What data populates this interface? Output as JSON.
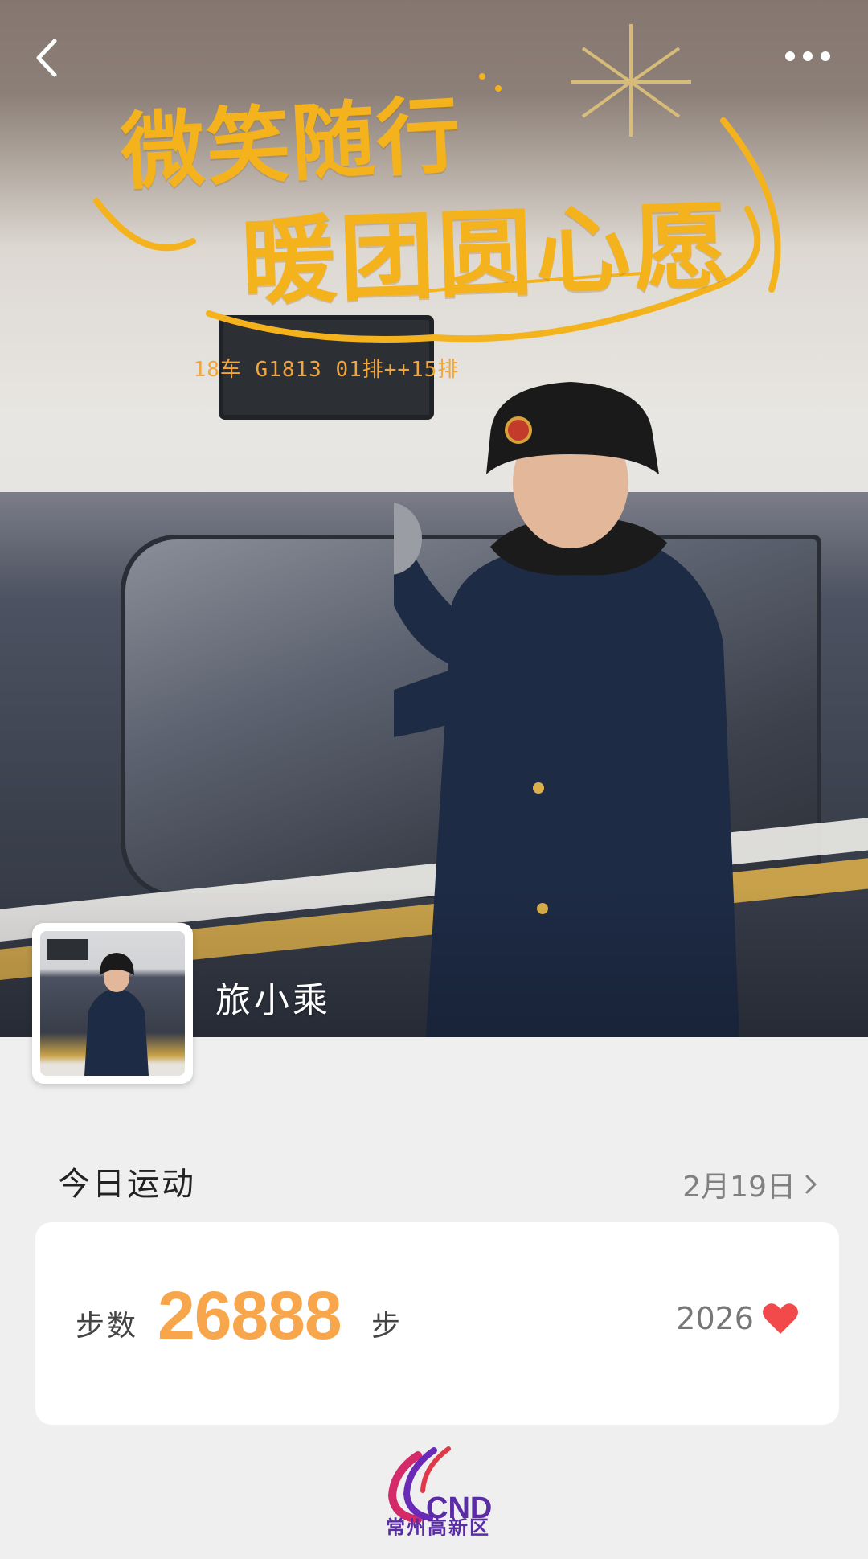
{
  "hero": {
    "headline_line1": "微笑随行",
    "headline_line2": "暖团圆心愿",
    "led_sign_text": "18车 G1813 01排++15排"
  },
  "nav": {
    "back_icon": "chevron-left-icon",
    "more_icon": "more-dots-icon"
  },
  "profile": {
    "name": "旅小乘"
  },
  "exercise": {
    "title": "今日运动",
    "date": "2月19日",
    "steps_label": "步数",
    "steps_value": "26888",
    "steps_unit": "步",
    "likes": "2026",
    "heart_color": "#f24a4a",
    "steps_color": "#f7a64b"
  },
  "logo": {
    "mark": "CND",
    "subtitle": "常州高新区"
  }
}
